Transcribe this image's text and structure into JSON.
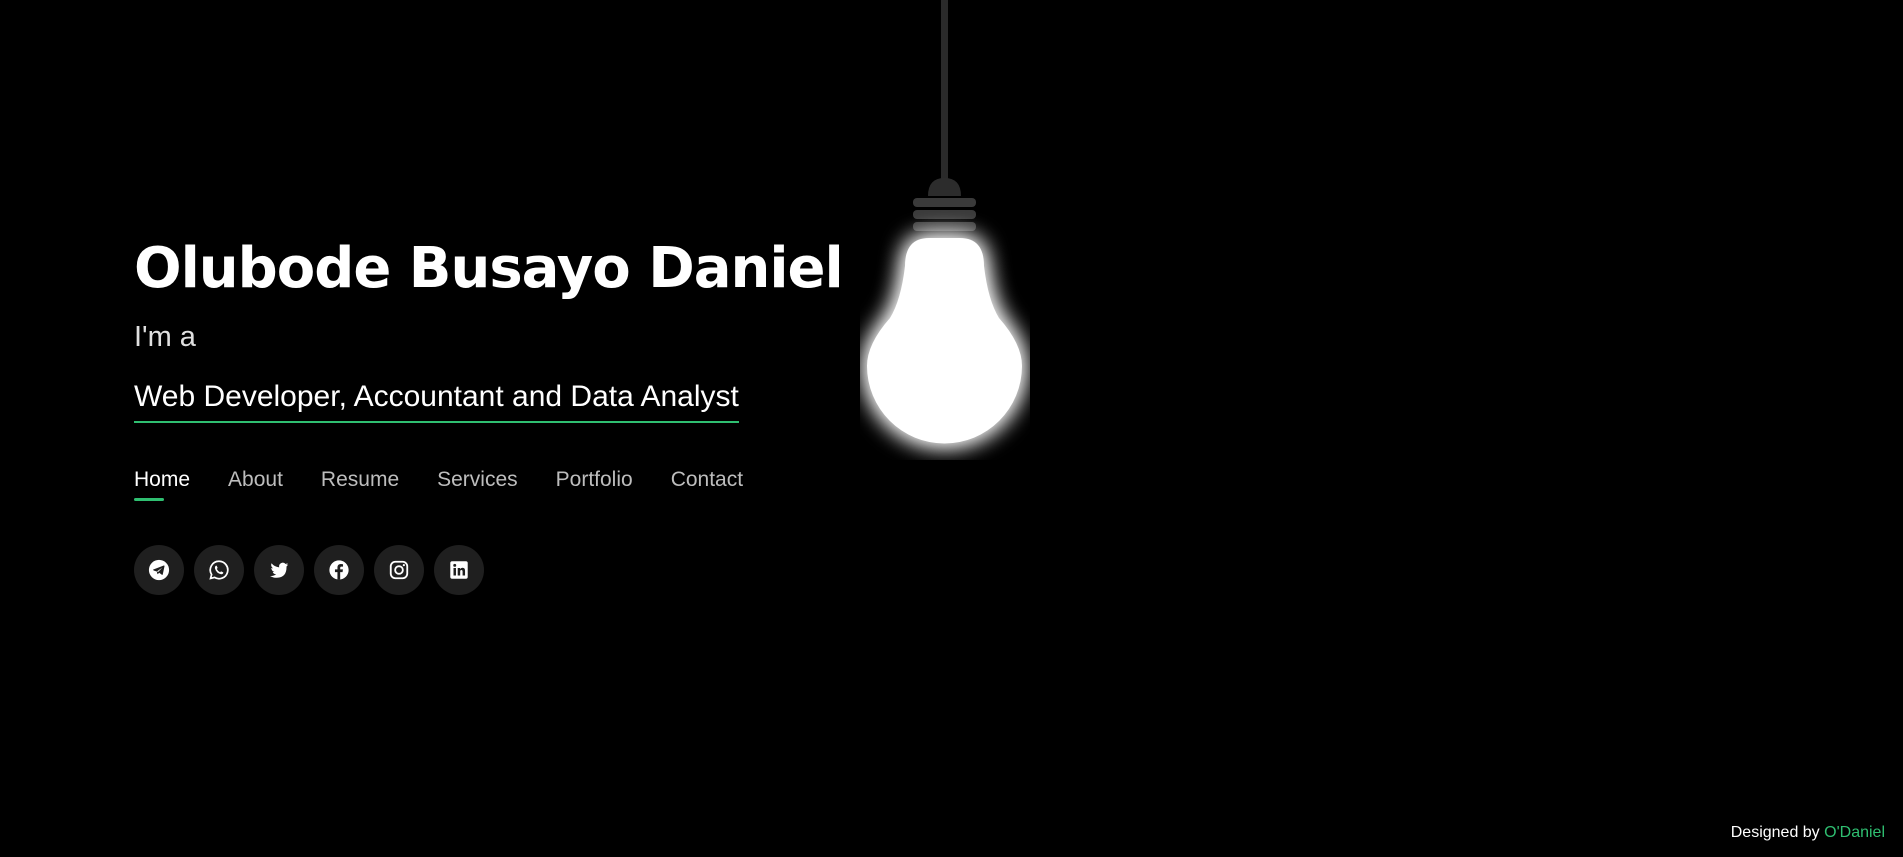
{
  "hero": {
    "name": "Olubode Busayo Daniel",
    "intro": "I'm a",
    "role": "Web Developer, Accountant and Data Analyst"
  },
  "nav": {
    "items": [
      {
        "label": "Home",
        "active": true
      },
      {
        "label": "About",
        "active": false
      },
      {
        "label": "Resume",
        "active": false
      },
      {
        "label": "Services",
        "active": false
      },
      {
        "label": "Portfolio",
        "active": false
      },
      {
        "label": "Contact",
        "active": false
      }
    ]
  },
  "social": {
    "icons": [
      "telegram-icon",
      "whatsapp-icon",
      "twitter-icon",
      "facebook-icon",
      "instagram-icon",
      "linkedin-icon"
    ]
  },
  "footer": {
    "prefix": "Designed by",
    "author": "O'Daniel"
  },
  "colors": {
    "background": "#000000",
    "accent": "#2fbf71",
    "nav_inactive": "#bdbdbd",
    "social_bg": "#1f1f1f"
  }
}
